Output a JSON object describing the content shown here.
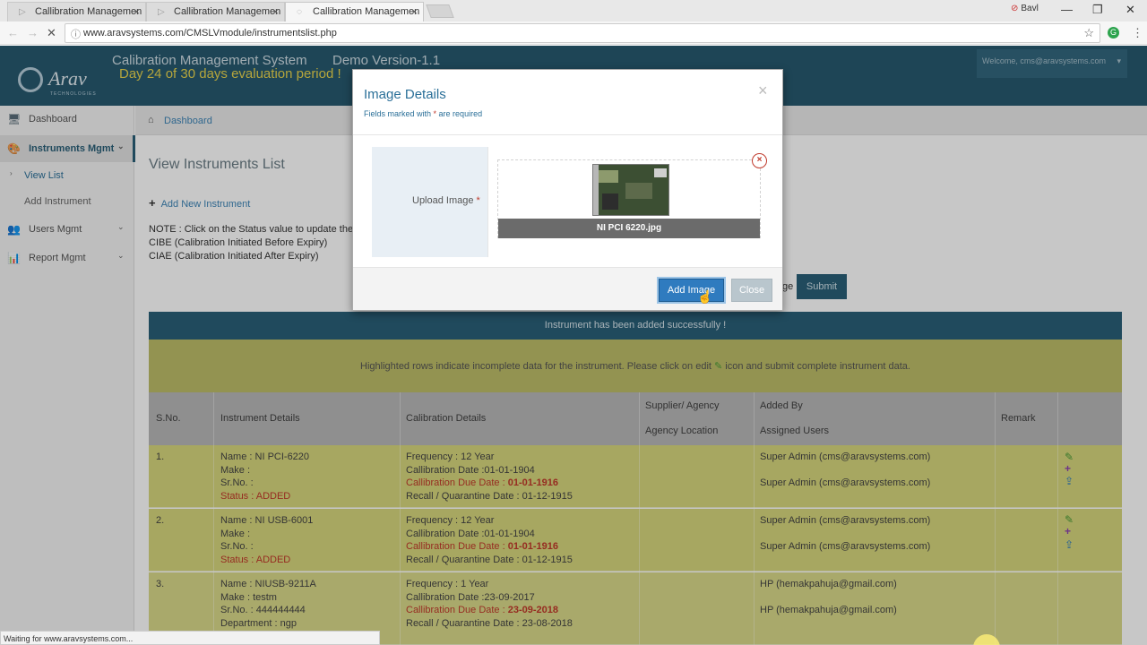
{
  "browser": {
    "tabs": [
      {
        "label": "Callibration Managemen",
        "active": false
      },
      {
        "label": "Callibration Managemen",
        "active": false
      },
      {
        "label": "Callibration Managemen",
        "active": true
      }
    ],
    "user_chip": "Bavl",
    "url": "www.aravsystems.com/CMSLVmodule/instrumentslist.php",
    "status_text": "Waiting for www.aravsystems.com..."
  },
  "header": {
    "logo_name": "Arav",
    "logo_sub": "TECHNOLOGIES",
    "app_title": "Calibration Management System",
    "version": "Demo Version-1.1",
    "trial": "Day 24 of 30 days evaluation period !",
    "welcome": "Welcome, cms@aravsystems.com"
  },
  "sidebar": {
    "items": [
      {
        "label": "Dashboard",
        "icon": "monitor-icon"
      },
      {
        "label": "Instruments Mgmt",
        "icon": "palette-icon"
      },
      {
        "label": "Users Mgmt",
        "icon": "users-icon"
      },
      {
        "label": "Report Mgmt",
        "icon": "bar-chart-icon"
      }
    ],
    "sub_items": [
      "View List",
      "Add Instrument"
    ]
  },
  "breadcrumb": "Dashboard",
  "main": {
    "title": "View Instruments List",
    "add_new": "Add New Instrument",
    "notes": [
      "NOTE : Click on the Status value to update the S",
      "CIBE (Calibration Initiated Before Expiry)",
      "CIAE (Calibration Initiated After Expiry)"
    ],
    "filter_label": "ge",
    "submit": "Submit",
    "success": "Instrument has been added successfully !",
    "hint_before": "Highlighted rows indicate incomplete data for the instrument. Please click on edit ",
    "hint_after": " icon and submit complete instrument data."
  },
  "table": {
    "headers": {
      "sno": "S.No.",
      "instrument": "Instrument Details",
      "calibration": "Calibration Details",
      "supplier": "Supplier/ Agency",
      "agency_location": "Agency Location",
      "added_by": "Added By",
      "assigned_users": "Assigned Users",
      "remark": "Remark"
    },
    "rows": [
      {
        "sno": "1.",
        "name": "Name : NI PCI-6220",
        "make": "Make :",
        "srno": "Sr.No. :",
        "status": "Status : ADDED",
        "frequency": "Frequency : 12 Year",
        "cal_date": "Callibration Date :01-01-1904",
        "due_label": "Callibration Due Date : ",
        "due_value": "01-01-1916",
        "recall": "Recall / Quarantine Date : 01-12-1915",
        "added_by": "Super Admin (cms@aravsystems.com)",
        "assigned": "Super Admin (cms@aravsystems.com)"
      },
      {
        "sno": "2.",
        "name": "Name : NI USB-6001",
        "make": "Make :",
        "srno": "Sr.No. :",
        "status": "Status : ADDED",
        "frequency": "Frequency : 12 Year",
        "cal_date": "Callibration Date :01-01-1904",
        "due_label": "Callibration Due Date : ",
        "due_value": "01-01-1916",
        "recall": "Recall / Quarantine Date : 01-12-1915",
        "added_by": "Super Admin (cms@aravsystems.com)",
        "assigned": "Super Admin (cms@aravsystems.com)"
      },
      {
        "sno": "3.",
        "name": "Name : NIUSB-9211A",
        "make": "Make : testm",
        "srno": "Sr.No. : 444444444",
        "dept": "Department : ngp",
        "frequency": "Frequency : 1 Year",
        "cal_date": "Callibration Date :23-09-2017",
        "due_label": "Callibration Due Date : ",
        "due_value": "23-09-2018",
        "recall": "Recall / Quarantine Date : 23-08-2018",
        "added_by": "HP (hemakpahuja@gmail.com)",
        "assigned": "HP (hemakpahuja@gmail.com)"
      }
    ]
  },
  "modal": {
    "title": "Image Details",
    "sub_before": "Fields marked with ",
    "sub_star": "*",
    "sub_after": " are required",
    "upload_label": "Upload Image ",
    "req_star": "*",
    "file_name": "NI PCI 6220.jpg",
    "add_button": "Add Image",
    "close_button": "Close"
  }
}
